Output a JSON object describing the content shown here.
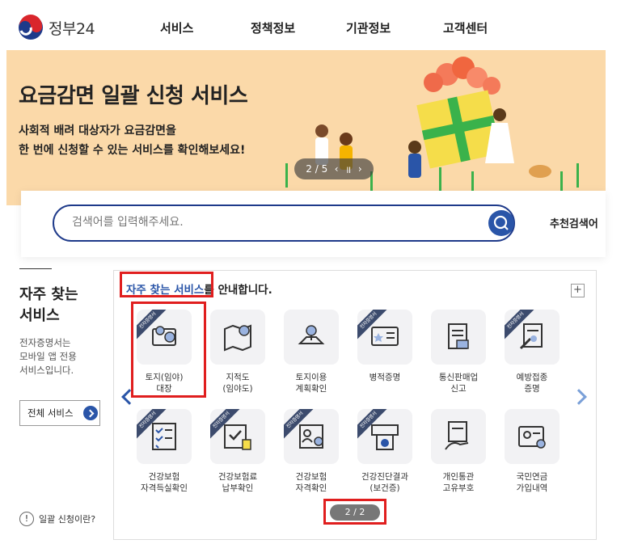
{
  "header": {
    "logo_text": "정부24",
    "nav": [
      "서비스",
      "정책정보",
      "기관정보",
      "고객센터"
    ]
  },
  "banner": {
    "title": "요금감면 일괄 신청 서비스",
    "desc_line1": "사회적 배려 대상자가 요금감면을",
    "desc_line2": "한 번에 신청할 수 있는 서비스를 확인해보세요!",
    "slide_indicator": "2 / 5",
    "prev_symbol": "‹",
    "pause_symbol": "॥",
    "next_symbol": "›",
    "colors": {
      "background": "#fbd9a9",
      "box": "#f5dd4a",
      "ribbon": "#3ab24b"
    }
  },
  "search": {
    "placeholder": "검색어를 입력해주세요.",
    "recommend_label": "추천검색어"
  },
  "sidebar": {
    "title_line1": "자주 찾는",
    "title_line2": "서비스",
    "desc_line1": "전자증명서는",
    "desc_line2": "모바일 앱 전용",
    "desc_line3": "서비스입니다.",
    "all_button": "전체 서비스",
    "help_mark": "!",
    "help_text": "일괄 신청이란?"
  },
  "panel": {
    "heading_highlight": "자주 찾는 서비스",
    "heading_rest": "를 안내합니다.",
    "expand_symbol": "+",
    "ribbon_text": "전자증명서",
    "pager": "2 / 2",
    "accent_color": "#2a55a8",
    "items": [
      {
        "l1": "토지(임야)",
        "l2": "대장",
        "icon": "land-register-icon",
        "ribbon": true
      },
      {
        "l1": "지적도",
        "l2": "(임야도)",
        "icon": "cadastral-map-icon",
        "ribbon": false
      },
      {
        "l1": "토지이용",
        "l2": "계획확인",
        "icon": "land-use-plan-icon",
        "ribbon": false
      },
      {
        "l1": "병적증명",
        "l2": "",
        "icon": "military-record-icon",
        "ribbon": true
      },
      {
        "l1": "통신판매업",
        "l2": "신고",
        "icon": "mail-order-business-icon",
        "ribbon": false
      },
      {
        "l1": "예방접종",
        "l2": "증명",
        "icon": "vaccination-icon",
        "ribbon": true
      },
      {
        "l1": "건강보험",
        "l2": "자격득실확인",
        "icon": "health-insurance-qualification-icon",
        "ribbon": true
      },
      {
        "l1": "건강보험료",
        "l2": "납부확인",
        "icon": "insurance-payment-icon",
        "ribbon": true
      },
      {
        "l1": "건강보험",
        "l2": "자격확인",
        "icon": "insurance-eligibility-icon",
        "ribbon": true
      },
      {
        "l1": "건강진단결과",
        "l2": "(보건증)",
        "icon": "health-checkup-icon",
        "ribbon": true
      },
      {
        "l1": "개인통관",
        "l2": "고유부호",
        "icon": "customs-code-icon",
        "ribbon": false
      },
      {
        "l1": "국민연금",
        "l2": "가입내역",
        "icon": "national-pension-icon",
        "ribbon": false
      }
    ]
  }
}
